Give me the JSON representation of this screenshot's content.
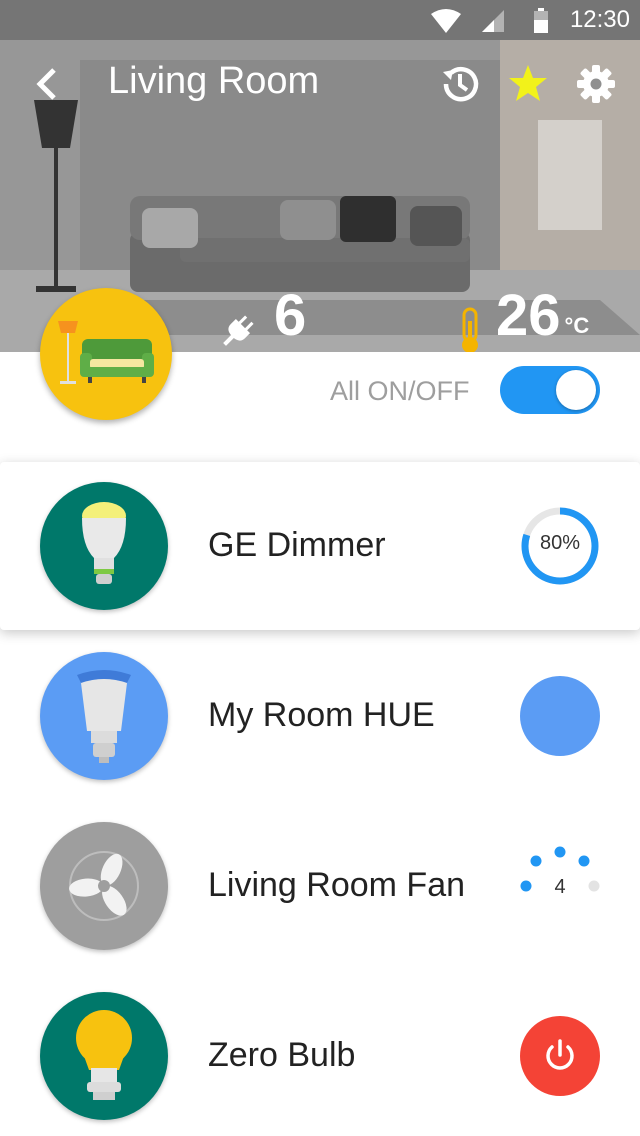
{
  "status_bar": {
    "time": "12:30"
  },
  "toolbar": {
    "title": "Living Room"
  },
  "stats": {
    "devices": "6",
    "temperature": "26",
    "temperature_unit": "°C"
  },
  "all_toggle": {
    "label": "All ON/OFF",
    "on": true
  },
  "devices": [
    {
      "name": "GE Dimmer",
      "control": "dimmer",
      "level_percent": 80,
      "level_label": "80%",
      "icon_color": "#00786a",
      "selected": true
    },
    {
      "name": "My Room HUE",
      "control": "color",
      "color": "#5b9cf4",
      "icon_color": "#5b9cf4"
    },
    {
      "name": "Living Room Fan",
      "control": "fan",
      "speed": "4",
      "icon_color": "#9e9e9e"
    },
    {
      "name": "Zero Bulb",
      "control": "power",
      "icon_color": "#00786a",
      "power_color": "#f44336"
    }
  ],
  "colors": {
    "accent": "#2196f3",
    "room_badge": "#f7c20f"
  }
}
